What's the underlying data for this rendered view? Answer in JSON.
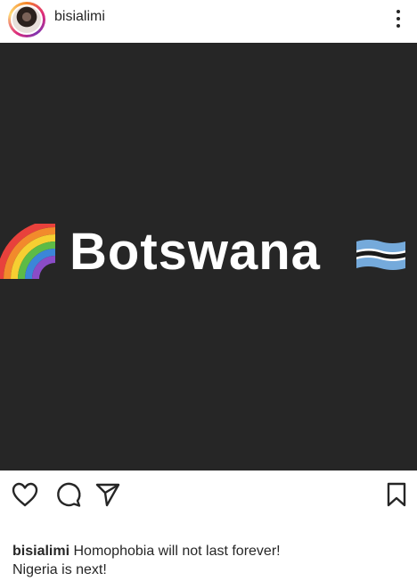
{
  "post": {
    "username": "bisialimi",
    "image_text": "Botswana",
    "image_emoji_left": "rainbow-emoji",
    "image_emoji_right": "botswana-flag-emoji",
    "image_background": "#262626"
  },
  "caption": {
    "author": "bisialimi",
    "text_line1": "Homophobia will not last forever!",
    "text_line2": "Nigeria is next!"
  },
  "icons": {
    "more": "more-options-icon",
    "like": "heart-icon",
    "comment": "comment-icon",
    "share": "send-icon",
    "save": "bookmark-icon"
  }
}
